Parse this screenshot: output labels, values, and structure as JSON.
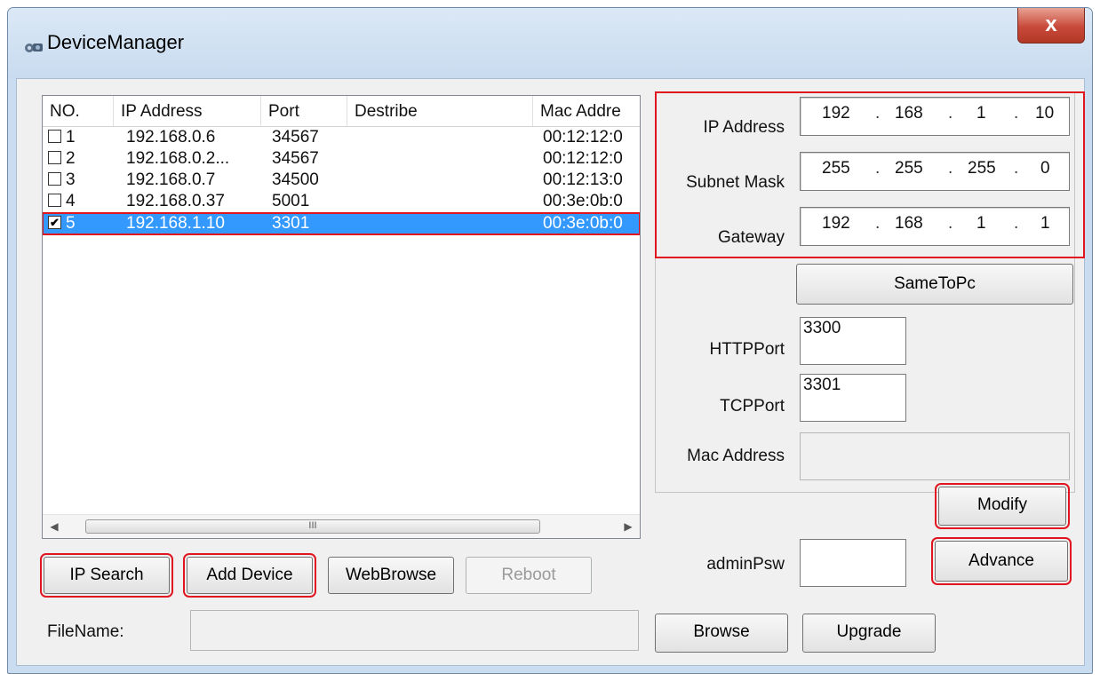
{
  "window": {
    "title": "DeviceManager",
    "close_glyph": "x"
  },
  "list": {
    "columns": [
      "NO.",
      "IP Address",
      "Port",
      "Destribe",
      "Mac Addre"
    ],
    "rows": [
      {
        "no": "1",
        "ip": "192.168.0.6",
        "port": "34567",
        "describe": "",
        "mac": "00:12:12:0",
        "checked": false,
        "check_glyph": ""
      },
      {
        "no": "2",
        "ip": "192.168.0.2...",
        "port": "34567",
        "describe": "",
        "mac": "00:12:12:0",
        "checked": false,
        "check_glyph": ""
      },
      {
        "no": "3",
        "ip": "192.168.0.7",
        "port": "34500",
        "describe": "",
        "mac": "00:12:13:0",
        "checked": false,
        "check_glyph": ""
      },
      {
        "no": "4",
        "ip": "192.168.0.37",
        "port": "5001",
        "describe": "",
        "mac": "00:3e:0b:0",
        "checked": false,
        "check_glyph": ""
      },
      {
        "no": "5",
        "ip": "192.168.1.10",
        "port": "3301",
        "describe": "",
        "mac": "00:3e:0b:0",
        "checked": true,
        "check_glyph": "✔"
      }
    ],
    "scroll_thumb_grip": "III",
    "scroll_left": "◀",
    "scroll_right": "▶"
  },
  "buttons": {
    "ip_search": "IP Search",
    "add_device": "Add Device",
    "web_browse": "WebBrowse",
    "reboot": "Reboot",
    "browse": "Browse",
    "upgrade": "Upgrade",
    "same_to_pc": "SameToPc",
    "modify": "Modify",
    "advance": "Advance"
  },
  "file": {
    "label": "FileName:",
    "value": ""
  },
  "config": {
    "ip_label": "IP Address",
    "ip": [
      "192",
      "168",
      "1",
      "10"
    ],
    "mask_label": "Subnet Mask",
    "mask": [
      "255",
      "255",
      "255",
      "0"
    ],
    "gateway_label": "Gateway",
    "gateway": [
      "192",
      "168",
      "1",
      "1"
    ],
    "http_label": "HTTPPort",
    "http_value": "3300",
    "tcp_label": "TCPPort",
    "tcp_value": "3301",
    "mac_label": "Mac Address",
    "mac_value": "",
    "psw_label": "adminPsw",
    "psw_value": "",
    "dot": "."
  },
  "colors": {
    "selection": "#3399ff",
    "highlight": "#e0151f"
  }
}
